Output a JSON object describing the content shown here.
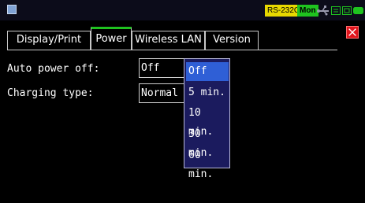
{
  "statusbar": {
    "rs_label": "RS-232C",
    "mon_label": "Mon"
  },
  "tabs": [
    {
      "label": "Display/Print",
      "active": false
    },
    {
      "label": "Power",
      "active": true
    },
    {
      "label": "Wireless LAN",
      "active": false
    },
    {
      "label": "Version",
      "active": false
    }
  ],
  "form": {
    "auto_power_off": {
      "label": "Auto power off:",
      "value": "Off"
    },
    "charging_type": {
      "label": "Charging type:",
      "value": "Normal ch"
    }
  },
  "dropdown": {
    "options": [
      "Off",
      "5 min.",
      "10 min.",
      "30 min.",
      "60 min."
    ],
    "selected": "Off"
  },
  "colors": {
    "accent_green": "#1fc31f",
    "close_red": "#e0151d",
    "dropdown_bg": "#1b1b5e",
    "selection_blue": "#2f5fd6"
  }
}
